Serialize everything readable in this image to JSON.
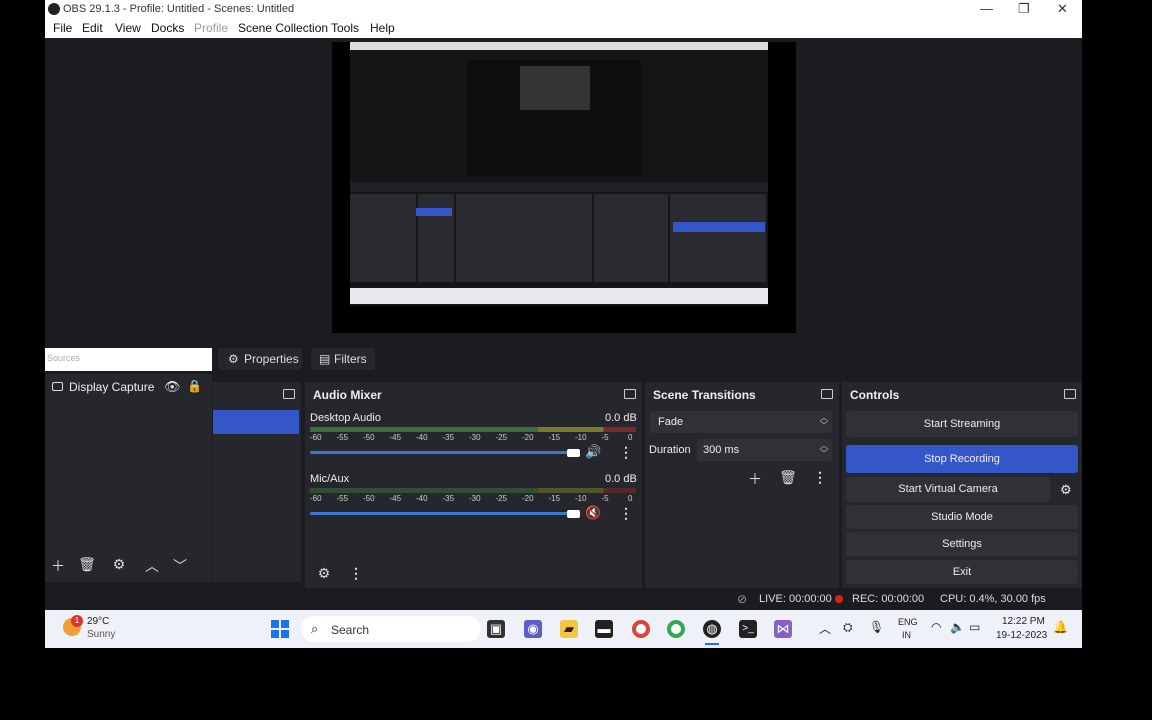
{
  "titlebar": {
    "title": "OBS 29.1.3 - Profile: Untitled - Scenes: Untitled"
  },
  "menu": [
    "File",
    "Edit",
    "View",
    "Docks",
    "Profile",
    "Scene Collection",
    "Tools",
    "Help"
  ],
  "tabs": {
    "sources": "Sources",
    "properties": "Properties",
    "filters": "Filters"
  },
  "sources": {
    "item": "Display Capture"
  },
  "audio_mixer": {
    "title": "Audio Mixer",
    "channels": [
      {
        "name": "Desktop Audio",
        "db": "0.0 dB",
        "volume_pct": 100
      },
      {
        "name": "Mic/Aux",
        "db": "0.0 dB",
        "volume_pct": 100
      }
    ],
    "scale": [
      "-60",
      "-55",
      "-50",
      "-45",
      "-40",
      "-35",
      "-30",
      "-25",
      "-20",
      "-15",
      "-10",
      "-5",
      "0"
    ]
  },
  "transitions": {
    "title": "Scene Transitions",
    "selected": "Fade",
    "duration_label": "Duration",
    "duration_value": "300 ms"
  },
  "controls": {
    "title": "Controls",
    "start_streaming": "Start Streaming",
    "stop_recording": "Stop Recording",
    "start_virtual_camera": "Start Virtual Camera",
    "studio_mode": "Studio Mode",
    "settings": "Settings",
    "exit": "Exit"
  },
  "status": {
    "live": "LIVE: 00:00:00",
    "rec": "REC: 00:00:00",
    "cpu": "CPU: 0.4%, 30.00 fps"
  },
  "taskbar": {
    "weather_temp": "29°C",
    "weather_desc": "Sunny",
    "notification_count": "1",
    "search": "Search",
    "lang": "ENG",
    "region": "IN",
    "time": "12:22 PM",
    "date": "19-12-2023"
  },
  "colors": {
    "accent": "#3556c9",
    "panel": "#26272c",
    "background": "#1b1c20"
  }
}
